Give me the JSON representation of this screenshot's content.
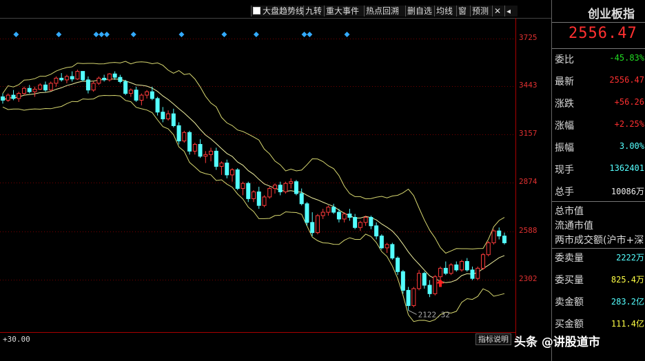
{
  "toolbar": {
    "checkbox_label": "大盘趋势线",
    "buttons": [
      "九转",
      "重大事件",
      "热点回溯",
      "删自选",
      "均线",
      "窗",
      "预测"
    ]
  },
  "chart_data": {
    "type": "candlestick",
    "yticks": [
      3725,
      3443,
      3157,
      2874,
      2588,
      2302
    ],
    "ylim": [
      1994,
      3845
    ],
    "low_annotation": "2122.32",
    "ohlc": [
      [
        3380,
        3400,
        3340,
        3360
      ],
      [
        3360,
        3400,
        3350,
        3390
      ],
      [
        3390,
        3420,
        3360,
        3370
      ],
      [
        3370,
        3410,
        3350,
        3400
      ],
      [
        3400,
        3440,
        3390,
        3430
      ],
      [
        3430,
        3450,
        3400,
        3410
      ],
      [
        3410,
        3440,
        3380,
        3425
      ],
      [
        3425,
        3460,
        3420,
        3450
      ],
      [
        3450,
        3470,
        3410,
        3420
      ],
      [
        3420,
        3470,
        3415,
        3460
      ],
      [
        3460,
        3500,
        3440,
        3490
      ],
      [
        3490,
        3520,
        3470,
        3480
      ],
      [
        3480,
        3510,
        3460,
        3500
      ],
      [
        3500,
        3530,
        3470,
        3485
      ],
      [
        3485,
        3540,
        3480,
        3530
      ],
      [
        3530,
        3530,
        3470,
        3480
      ],
      [
        3480,
        3500,
        3400,
        3420
      ],
      [
        3420,
        3470,
        3410,
        3460
      ],
      [
        3460,
        3500,
        3450,
        3490
      ],
      [
        3490,
        3510,
        3470,
        3480
      ],
      [
        3480,
        3520,
        3470,
        3515
      ],
      [
        3515,
        3530,
        3480,
        3495
      ],
      [
        3495,
        3510,
        3460,
        3470
      ],
      [
        3470,
        3480,
        3390,
        3400
      ],
      [
        3400,
        3430,
        3380,
        3420
      ],
      [
        3420,
        3440,
        3350,
        3360
      ],
      [
        3360,
        3400,
        3330,
        3390
      ],
      [
        3390,
        3420,
        3370,
        3410
      ],
      [
        3410,
        3440,
        3360,
        3370
      ],
      [
        3370,
        3380,
        3270,
        3290
      ],
      [
        3290,
        3320,
        3230,
        3250
      ],
      [
        3250,
        3300,
        3240,
        3280
      ],
      [
        3280,
        3310,
        3200,
        3210
      ],
      [
        3210,
        3230,
        3100,
        3120
      ],
      [
        3120,
        3180,
        3110,
        3170
      ],
      [
        3170,
        3180,
        3040,
        3060
      ],
      [
        3060,
        3110,
        3040,
        3100
      ],
      [
        3100,
        3130,
        3020,
        3030
      ],
      [
        3030,
        3060,
        2990,
        3040
      ],
      [
        3040,
        3080,
        3000,
        3060
      ],
      [
        3060,
        3080,
        2950,
        2970
      ],
      [
        2970,
        3000,
        2920,
        2990
      ],
      [
        2990,
        3010,
        2900,
        2920
      ],
      [
        2920,
        2960,
        2880,
        2950
      ],
      [
        2950,
        2960,
        2830,
        2840
      ],
      [
        2840,
        2880,
        2800,
        2870
      ],
      [
        2870,
        2880,
        2760,
        2780
      ],
      [
        2780,
        2830,
        2760,
        2820
      ],
      [
        2820,
        2850,
        2720,
        2740
      ],
      [
        2740,
        2800,
        2730,
        2790
      ],
      [
        2790,
        2850,
        2780,
        2840
      ],
      [
        2840,
        2870,
        2810,
        2860
      ],
      [
        2860,
        2880,
        2800,
        2820
      ],
      [
        2820,
        2880,
        2810,
        2870
      ],
      [
        2870,
        2900,
        2840,
        2880
      ],
      [
        2880,
        2890,
        2800,
        2810
      ],
      [
        2810,
        2840,
        2740,
        2750
      ],
      [
        2750,
        2760,
        2620,
        2640
      ],
      [
        2640,
        2700,
        2560,
        2580
      ],
      [
        2580,
        2690,
        2570,
        2680
      ],
      [
        2680,
        2720,
        2660,
        2700
      ],
      [
        2700,
        2740,
        2680,
        2730
      ],
      [
        2730,
        2750,
        2690,
        2700
      ],
      [
        2700,
        2720,
        2640,
        2660
      ],
      [
        2660,
        2700,
        2640,
        2690
      ],
      [
        2690,
        2720,
        2650,
        2670
      ],
      [
        2670,
        2690,
        2600,
        2610
      ],
      [
        2610,
        2650,
        2590,
        2640
      ],
      [
        2640,
        2680,
        2620,
        2670
      ],
      [
        2670,
        2680,
        2600,
        2620
      ],
      [
        2620,
        2640,
        2540,
        2560
      ],
      [
        2560,
        2570,
        2480,
        2490
      ],
      [
        2490,
        2520,
        2460,
        2510
      ],
      [
        2510,
        2520,
        2420,
        2430
      ],
      [
        2430,
        2440,
        2330,
        2350
      ],
      [
        2350,
        2360,
        2220,
        2240
      ],
      [
        2240,
        2260,
        2122,
        2150
      ],
      [
        2150,
        2260,
        2140,
        2250
      ],
      [
        2250,
        2360,
        2240,
        2340
      ],
      [
        2340,
        2350,
        2250,
        2270
      ],
      [
        2270,
        2300,
        2200,
        2220
      ],
      [
        2220,
        2330,
        2210,
        2320
      ],
      [
        2320,
        2380,
        2300,
        2370
      ],
      [
        2370,
        2410,
        2330,
        2340
      ],
      [
        2340,
        2400,
        2330,
        2390
      ],
      [
        2390,
        2410,
        2350,
        2360
      ],
      [
        2360,
        2420,
        2350,
        2410
      ],
      [
        2410,
        2430,
        2350,
        2360
      ],
      [
        2360,
        2380,
        2300,
        2310
      ],
      [
        2310,
        2380,
        2300,
        2370
      ],
      [
        2370,
        2460,
        2360,
        2450
      ],
      [
        2450,
        2530,
        2440,
        2520
      ],
      [
        2520,
        2600,
        2510,
        2590
      ],
      [
        2590,
        2610,
        2540,
        2560
      ],
      [
        2560,
        2580,
        2510,
        2520
      ]
    ]
  },
  "bottom": {
    "zoom_label": "+30.00",
    "indicator_button": "指标说明"
  },
  "panel": {
    "title": "创业板指",
    "price": "2556.47",
    "rows": [
      {
        "label": "委比",
        "value": "-45.83%",
        "color": "green"
      },
      {
        "label": "最新",
        "value": "2556.47",
        "color": "red"
      },
      {
        "label": "涨跌",
        "value": "+56.26",
        "color": "red"
      },
      {
        "label": "涨幅",
        "value": "+2.25%",
        "color": "red"
      },
      {
        "label": "振幅",
        "value": "3.00%",
        "color": "cyan"
      },
      {
        "label": "现手",
        "value": "1362401",
        "color": "cyan"
      },
      {
        "label": "总手",
        "value": "10086万",
        "color": "white"
      }
    ],
    "plain_rows": [
      "总市值",
      "流通市值",
      "两市成交额(沪市+深"
    ],
    "rows2": [
      {
        "label": "委卖量",
        "value": "2222万",
        "color": "cyan"
      },
      {
        "label": "委买量",
        "value": "825.4万",
        "color": "yellow"
      },
      {
        "label": "卖金额",
        "value": "283.2亿",
        "color": "cyan"
      },
      {
        "label": "买金额",
        "value": "111.4亿",
        "color": "yellow"
      }
    ]
  },
  "watermark": "头条 @讲股道市",
  "colors": {
    "up": "#ff3b3b",
    "down": "#54ffff",
    "band": "#d8d870",
    "marker": "#33aaff",
    "arrow": "#ff2020"
  }
}
